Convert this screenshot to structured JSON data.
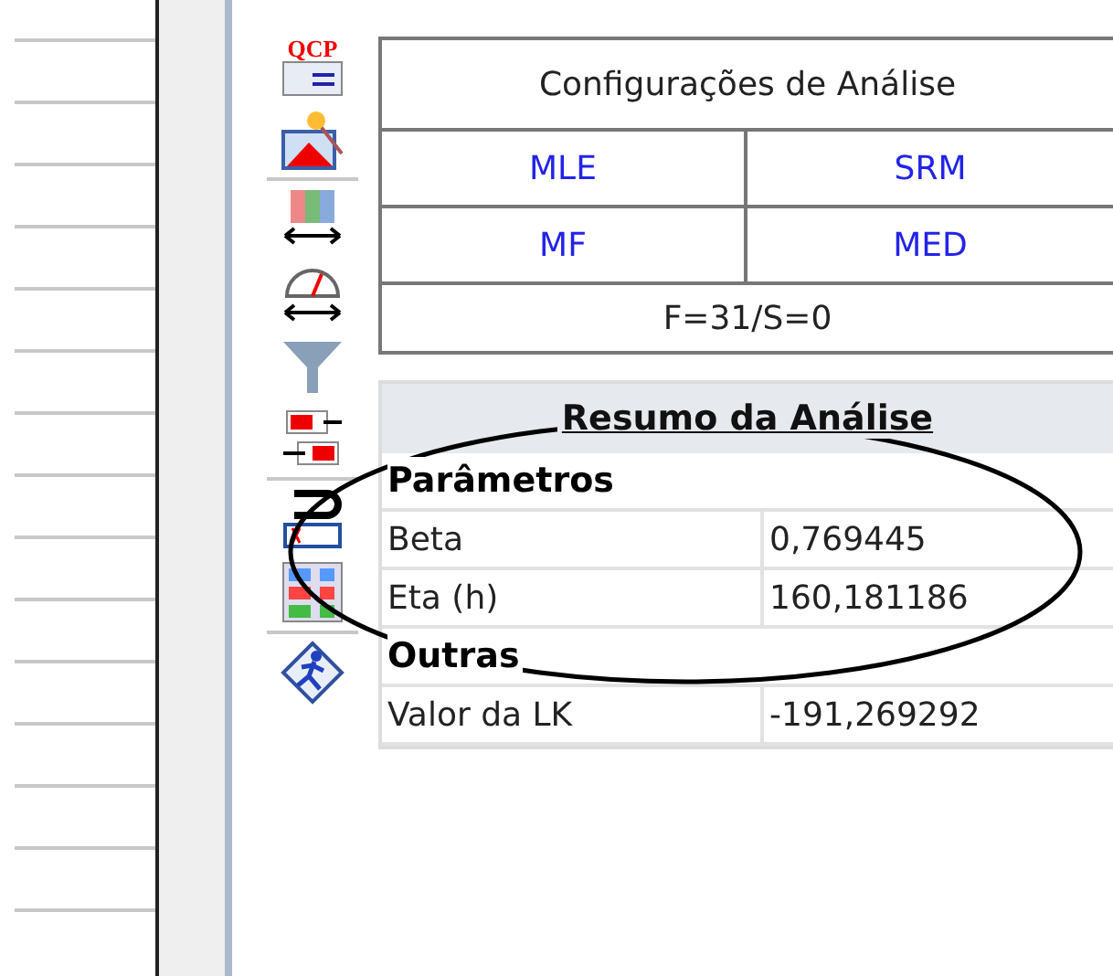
{
  "toolbar": {
    "icons": [
      {
        "kind": "qcp",
        "label": "QCP",
        "separator_after": false
      },
      {
        "kind": "wizard",
        "separator_after": true
      },
      {
        "kind": "grid",
        "separator_after": false
      },
      {
        "kind": "gauge",
        "separator_after": false
      },
      {
        "kind": "funnel",
        "separator_after": false
      },
      {
        "kind": "numbers",
        "separator_after": true
      },
      {
        "kind": "magnet",
        "separator_after": false
      },
      {
        "kind": "table",
        "separator_after": true
      },
      {
        "kind": "runner",
        "separator_after": false
      }
    ]
  },
  "config": {
    "title": "Configurações de Análise",
    "options": [
      [
        "MLE",
        "SRM"
      ],
      [
        "MF",
        "MED"
      ]
    ],
    "footer": "F=31/S=0"
  },
  "summary": {
    "title": "Resumo da Análise",
    "sections": [
      {
        "heading": "Parâmetros",
        "rows": [
          [
            "Beta",
            "0,769445"
          ],
          [
            "Eta (h)",
            "160,181186"
          ]
        ]
      },
      {
        "heading": "Outras",
        "rows": [
          [
            "Valor da LK",
            "-191,269292"
          ]
        ]
      }
    ]
  }
}
